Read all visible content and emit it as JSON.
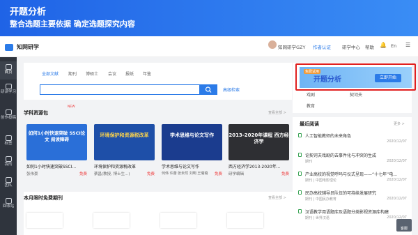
{
  "banner": {
    "title": "开题分析",
    "subtitle": "整合选题主要依据 确定选题探究内容"
  },
  "top": {
    "logo": "知网研学",
    "user": "知网研学GZY",
    "cert": "作者认证",
    "center": "研学中心",
    "help": "帮助",
    "lang": "En"
  },
  "side": [
    "首页",
    "研读学习",
    "创作投稿",
    "标签",
    "我的",
    "团队",
    "回收站"
  ],
  "search": {
    "tabs": [
      "全部文献",
      "期刊",
      "博硕士",
      "会议",
      "报纸",
      "年鉴"
    ],
    "advanced": "高级检索"
  },
  "resources": {
    "title": "学科资源包",
    "badge": "NEW",
    "more": "查看全部 >",
    "items": [
      {
        "cover": "如何1小时快速突破 SSCI论文 阅读障碍",
        "title": "如何1小时快速突破SSCI...",
        "author": "张伟豪",
        "price": "免费"
      },
      {
        "cover": "环境保护和资源税改革",
        "title": "环境保护和资源税改革",
        "author": "蔡昌(教授, 博士生...)",
        "price": "免费"
      },
      {
        "cover": "学术思维与论文写作",
        "title": "学术思维与论文写作",
        "author": "何伟 许蕾 张未然 刘明 王璐璐",
        "price": "免费"
      },
      {
        "cover": "2013-2020年课程 西方经济学",
        "title": "西方经济学2013-2020年...",
        "author": "研学编辑",
        "price": "免费"
      }
    ]
  },
  "promo": {
    "try": "免费试用",
    "title": "开题分析",
    "btn": "立即开始"
  },
  "right": {
    "l1": "戏剧",
    "l2": "契诃夫",
    "l3": "教育"
  },
  "latest": {
    "title": "最近阅读",
    "more": "更多 >",
    "items": [
      {
        "t": "人工智能教师的未来角色",
        "m": "",
        "d": "2020/12/07"
      },
      {
        "t": "论契诃夫戏剧的去事件化与冲突的生成",
        "m": "期刊",
        "d": "2020/12/07"
      },
      {
        "t": "产业高校的视觉呼吗与仪式呈现——“十七年”电...",
        "m": "期刊 | 中国电影理论",
        "d": "2020/12/07"
      },
      {
        "t": "民办高校辅导员队伍的可持续发展研究",
        "m": "期刊 | 中国民办教育",
        "d": "2020/12/07"
      },
      {
        "t": "汉语教学用语题库及语题分类影视资源库构建",
        "m": "期刊 | 世界汉语",
        "d": "2020/12/07"
      }
    ]
  },
  "journals": {
    "title": "本月限时免费期刊",
    "more": "查看全部 >"
  },
  "kefu": "客服"
}
